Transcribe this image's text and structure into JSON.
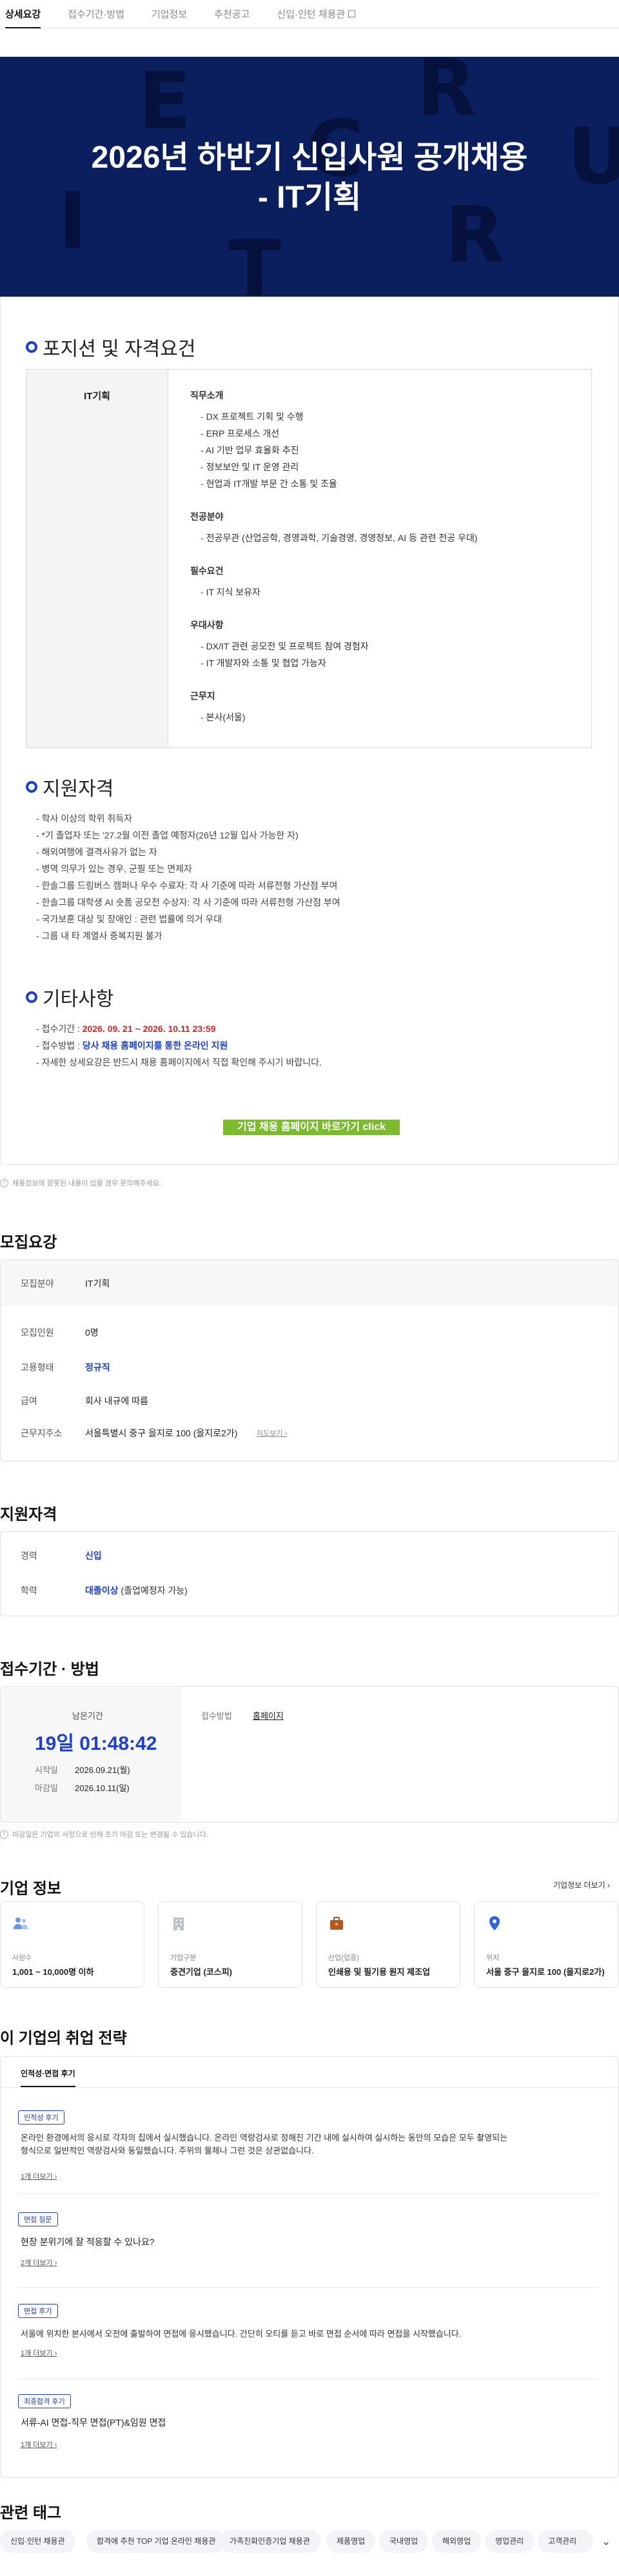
{
  "tabs": [
    "상세요강",
    "접수기간·방법",
    "기업정보",
    "추천공고",
    "신입·인턴 채용관"
  ],
  "banner": {
    "title_line1": "2026년 하반기 신입사원 공개채용",
    "title_line2": "- IT기획",
    "bg_letters": [
      "E",
      "R",
      "C",
      "U",
      "I",
      "T",
      "R"
    ]
  },
  "positions": {
    "heading": "포지션 및 자격요건",
    "row_label": "IT기획",
    "groups": [
      {
        "title": "직무소개",
        "items": [
          "DX 프로젝트 기획 및 수행",
          "ERP 프로세스 개선",
          "AI 기반 업무 효율화 추진",
          "정보보안 및 IT 운영 관리",
          "현업과 IT개발 부문 간 소통 및 조율"
        ]
      },
      {
        "title": "전공분야",
        "items": [
          "전공무관 (산업공학, 경영과학, 기술경영, 경영정보, AI 등 관련 전공 우대)"
        ]
      },
      {
        "title": "필수요건",
        "items": [
          "IT 지식 보유자"
        ]
      },
      {
        "title": "우대사항",
        "items": [
          "DX/IT 관련 공모전 및 프로젝트 참여 경험자",
          "IT 개발자와 소통 및 협업 가능자"
        ]
      },
      {
        "title": "근무지",
        "items": [
          "본사(서울)"
        ]
      }
    ]
  },
  "qualification": {
    "heading": "지원자격",
    "items": [
      "학사 이상의 학위 취득자",
      "*기 졸업자 또는 '27.2월 이전 졸업 예정자(26년 12월 입사 가능한 자)",
      "해외여행에 결격사유가 없는 자",
      "병역 의무가 있는 경우, 군필 또는 면제자",
      "한솔그룹 드림버스 캠퍼나 우수 수료자: 각 사 기준에 따라 서류전형 가산점 부여",
      "한솔그룹 대학생 AI 숏폼 공모전 수상자: 각 사 기준에 따라 서류전형 가산점 부여",
      "국가보훈 대상 및 장애인 : 관련 법률에 의거 우대",
      "그룹 내 타 계열사 중복지원 불가"
    ]
  },
  "others": {
    "heading": "기타사항",
    "period_label": "접수기간 :",
    "period_value": "2026. 09. 21 ~ 2026. 10.11 23:59",
    "method_label": "접수방법 :",
    "method_value": "당사 채용 홈페이지를 통한 온라인 지원",
    "note": "자세한 상세요강은 반드시 채용 홈페이지에서 직접 확인해 주시기 바랍니다.",
    "button": "기업 채용 홈페이지 바로가기 click"
  },
  "report_note": "채용정보에 잘못된 내용이 있을 경우 문의해주세요.",
  "recruit": {
    "heading": "모집요강",
    "rows": [
      {
        "k": "모집분야",
        "v": "IT기획"
      },
      {
        "k": "모집인원",
        "v": "0명"
      },
      {
        "k": "고용형태",
        "v": "정규직"
      },
      {
        "k": "급여",
        "v": "회사 내규에 따름"
      },
      {
        "k": "근무지주소",
        "v": "서울특별시 중구 을지로 100 (을지로2가)"
      }
    ],
    "map_link": "지도보기"
  },
  "apply": {
    "heading": "지원자격",
    "career_label": "경력",
    "career_value": "신입",
    "edu_label": "학력",
    "edu_value": "대졸이상",
    "edu_extra": "(졸업예정자 가능)"
  },
  "period": {
    "heading": "접수기간 · 방법",
    "remain_label": "남은기간",
    "remain_value": "19일 01:48:42",
    "start_label": "시작일",
    "start_value": "2026.09.21(월)",
    "end_label": "마감일",
    "end_value": "2026.10.11(일)",
    "method_label": "접수방법",
    "method_value": "홈페이지",
    "note": "마감일은 기업의 사정으로 인해 조기 마감 또는 변경될 수 있습니다."
  },
  "company": {
    "heading": "기업 정보",
    "more": "기업정보 더보기",
    "cards": [
      {
        "icon": "people-icon",
        "label": "사원수",
        "value": "1,001 ~ 10,000명 이하"
      },
      {
        "icon": "building-icon",
        "label": "기업구분",
        "value": "중견기업 (코스피)"
      },
      {
        "icon": "briefcase-icon",
        "label": "산업(업종)",
        "value": "인쇄용 및 필기용 원지 제조업"
      },
      {
        "icon": "location-icon",
        "label": "위치",
        "value": "서울 중구 을지로 100 (을지로2가)"
      }
    ]
  },
  "strategy": {
    "heading": "이 기업의 취업 전략",
    "tab": "인적성·면접 후기",
    "reviews": [
      {
        "badge": "인적성 후기",
        "text1": "온라인 환경에서의 응시로 각자의 집에서 실시했습니다. 온라인 역량검사로 정해진 기간 내에 실시하여 실시하는 동안의 모습은 모두 촬영되는",
        "text2": "형식으로 일반적인 역량검사와 동일했습니다. 주위의 물체나 그런 것은 상관없습니다.",
        "more": "1개 더보기"
      },
      {
        "badge": "면접 질문",
        "text1": "현장 분위기에 잘 적응할 수 있나요?",
        "text2": "",
        "more": "2개 더보기"
      },
      {
        "badge": "면접 후기",
        "text1": "서울에 위치한 본사에서 오전에 출발하여 면접에 응시했습니다. 간단히 오티를 듣고 바로 면접 순서에 따라 면접을 시작했습니다.",
        "text2": "",
        "more": "1개 더보기"
      },
      {
        "badge": "최종합격 후기",
        "text1": "서류-AI 면접-직무 면접(PT)&임원 면접",
        "text2": "",
        "more": "1개 더보기"
      }
    ]
  },
  "tags": {
    "heading": "관련 태그",
    "items": [
      "신입·인턴 채용관",
      "합격에 추천 TOP 기업 온라인 채용관",
      "가족친화인증기업 채용관",
      "제품영업",
      "국내영업",
      "해외영업",
      "영업관리",
      "고객관리"
    ]
  },
  "colors": {
    "navy": "#0b1f5e",
    "accent": "#1c3fd1",
    "red": "#d62020",
    "green": "#7cba2f"
  }
}
